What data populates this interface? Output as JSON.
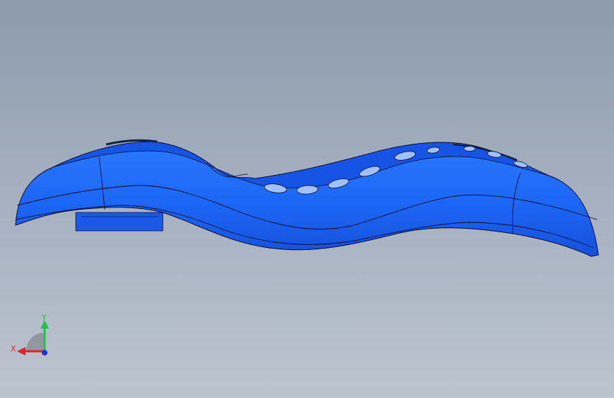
{
  "viewport": {
    "background_top": "#8c9aab",
    "background_bottom": "#bcc4cf"
  },
  "model": {
    "color": "#1f6bff",
    "shade_color": "#1450e0",
    "edge_color": "#0a0a30",
    "hole_count": 9
  },
  "triad": {
    "x_label": "X",
    "y_label": "Y",
    "x_color": "#e0202a",
    "y_color": "#22c24a",
    "z_color": "#2233dd"
  }
}
